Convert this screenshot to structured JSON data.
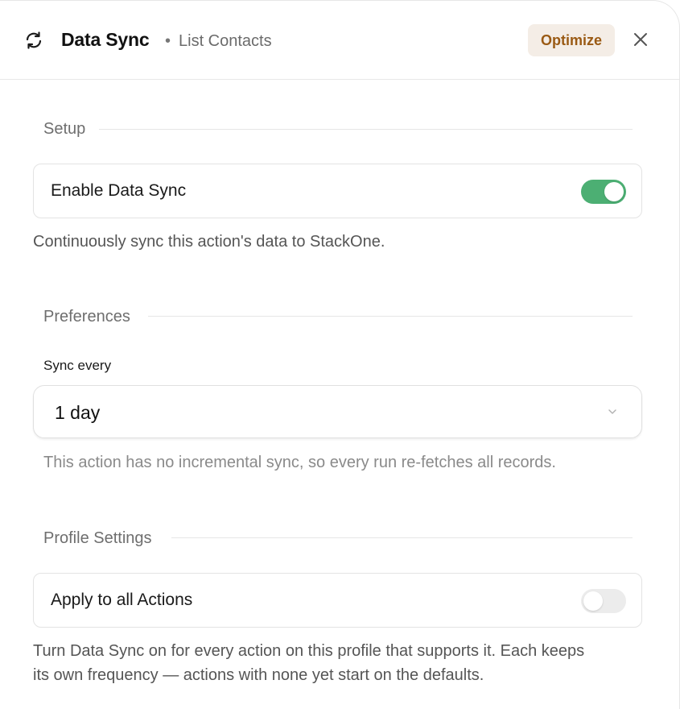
{
  "header": {
    "title": "Data Sync",
    "subtitle_dot": "•",
    "subtitle": "List Contacts",
    "optimize_label": "Optimize"
  },
  "sections": {
    "setup": {
      "label": "Setup",
      "toggle_label": "Enable Data Sync",
      "toggle_on": true,
      "description": "Continuously sync this action's data to StackOne."
    },
    "preferences": {
      "label": "Preferences",
      "field_label": "Sync every",
      "selected_value": "1 day",
      "hint": "This action has no incremental sync, so every run re-fetches all records."
    },
    "profile": {
      "label": "Profile Settings",
      "toggle_label": "Apply to all Actions",
      "toggle_on": false,
      "description_line1": "Turn Data Sync on for every action on this profile that supports it. Each keeps",
      "description_line2": "its own frequency — actions with none yet start on the defaults."
    }
  },
  "icons": {
    "header_icon": "sync-icon",
    "close": "close-icon",
    "select_caret": "chevron-down-icon"
  },
  "colors": {
    "toggle_on": "#4caf73",
    "toggle_off": "#ececec",
    "optimize_bg": "#f4ede6",
    "optimize_text": "#9a5a14"
  }
}
